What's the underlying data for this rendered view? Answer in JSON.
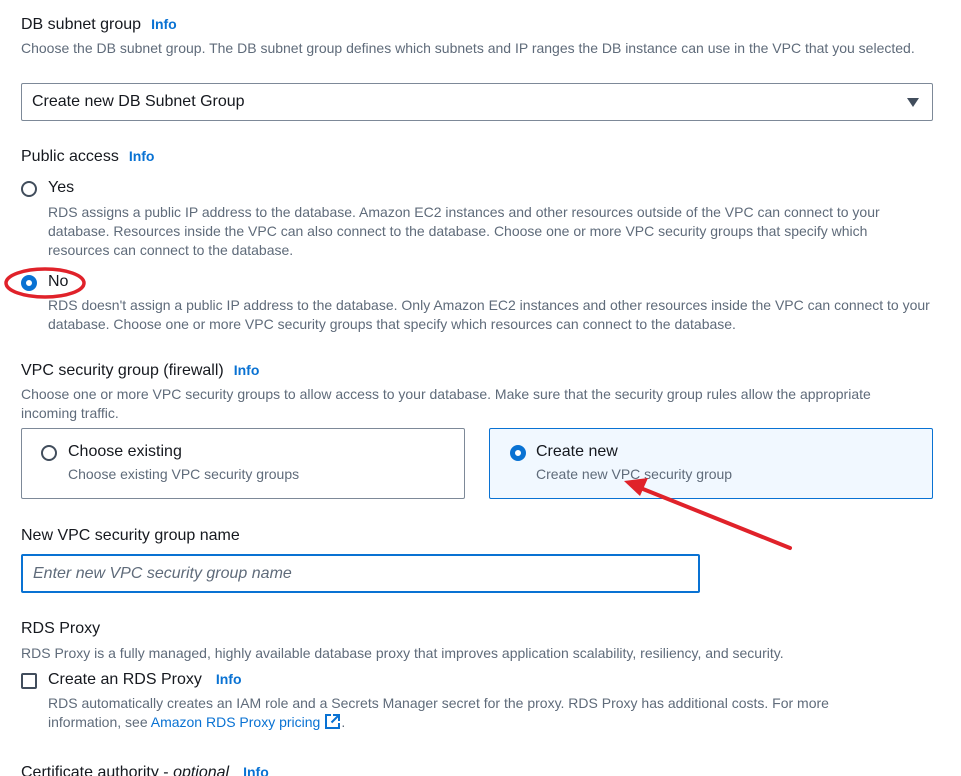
{
  "subnet": {
    "label": "DB subnet group",
    "info": "Info",
    "description": "Choose the DB subnet group. The DB subnet group defines which subnets and IP ranges the DB instance can use in the VPC that you selected.",
    "selected_value": "Create new DB Subnet Group"
  },
  "public_access": {
    "label": "Public access",
    "info": "Info",
    "options": [
      {
        "label": "Yes",
        "description": "RDS assigns a public IP address to the database. Amazon EC2 instances and other resources outside of the VPC can connect to your database. Resources inside the VPC can also connect to the database. Choose one or more VPC security groups that specify which resources can connect to the database.",
        "checked": false
      },
      {
        "label": "No",
        "description": "RDS doesn't assign a public IP address to the database. Only Amazon EC2 instances and other resources inside the VPC can connect to your database. Choose one or more VPC security groups that specify which resources can connect to the database.",
        "checked": true
      }
    ]
  },
  "vpc_sg": {
    "label": "VPC security group (firewall)",
    "info": "Info",
    "description": "Choose one or more VPC security groups to allow access to your database. Make sure that the security group rules allow the appropriate incoming traffic.",
    "tiles": [
      {
        "label": "Choose existing",
        "description": "Choose existing VPC security groups",
        "checked": false
      },
      {
        "label": "Create new",
        "description": "Create new VPC security group",
        "checked": true
      }
    ]
  },
  "new_sg_name": {
    "label": "New VPC security group name",
    "placeholder": "Enter new VPC security group name",
    "value": ""
  },
  "rds_proxy": {
    "label": "RDS Proxy",
    "description": "RDS Proxy is a fully managed, highly available database proxy that improves application scalability, resiliency, and security.",
    "checkbox_label": "Create an RDS Proxy",
    "info": "Info",
    "checkbox_desc_line1": "RDS automatically creates an IAM role and a Secrets Manager secret for the proxy. RDS Proxy has additional costs. For more",
    "checkbox_desc_prefix": "information, see ",
    "pricing_link": "Amazon RDS Proxy pricing",
    "checkbox_desc_suffix": ".",
    "checked": false
  },
  "certificate": {
    "label": "Certificate authority - ",
    "optional": "optional",
    "info": "Info"
  },
  "annotations": {
    "highlight_color": "#e0222a"
  },
  "colors": {
    "accent": "#0972d3",
    "text": "#16191f",
    "muted": "#5f6b7a",
    "selected_tile_bg": "#f1f8ff"
  }
}
